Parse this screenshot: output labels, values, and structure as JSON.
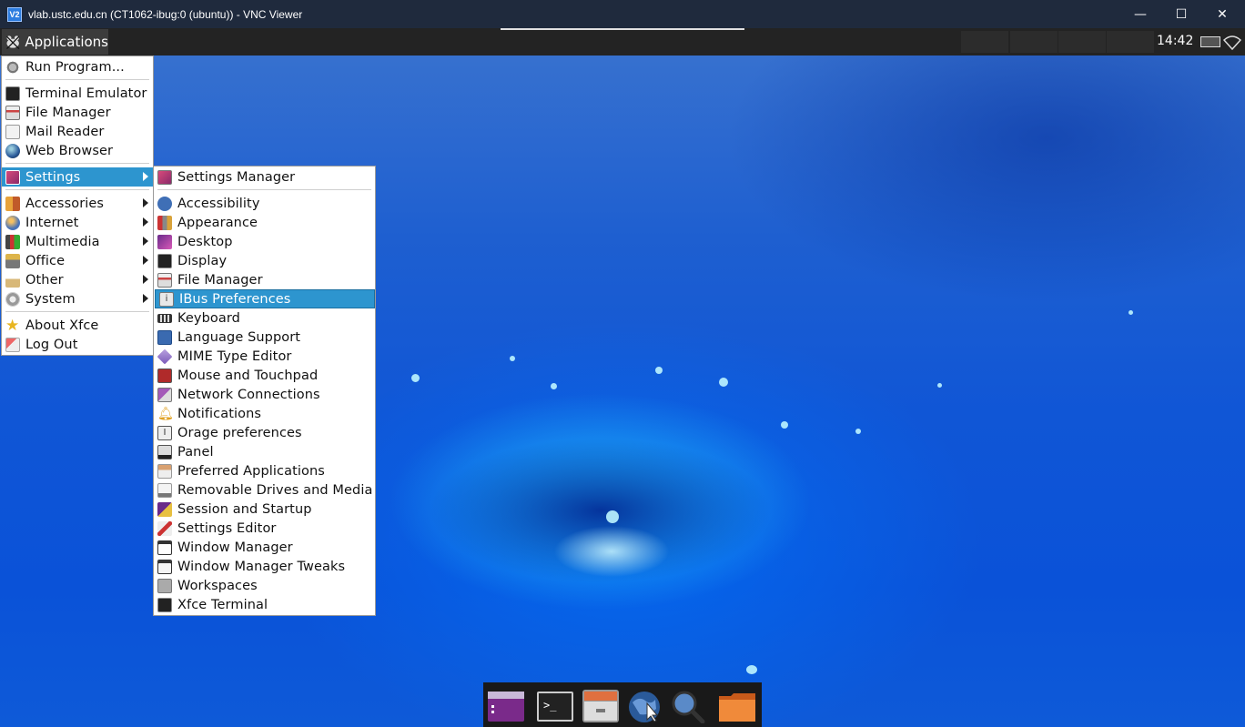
{
  "window": {
    "logo_text": "V2",
    "title": "vlab.ustc.edu.cn (CT1062-ibug:0 (ubuntu)) - VNC Viewer",
    "minimize_glyph": "—",
    "maximize_glyph": "☐",
    "close_glyph": "✕"
  },
  "panel": {
    "applications_label": "Applications",
    "clock": "14:42"
  },
  "apps_menu": {
    "items": [
      {
        "label": "Run Program...",
        "icon": "run-program-icon"
      },
      {
        "label": "Terminal Emulator",
        "icon": "terminal-icon"
      },
      {
        "label": "File Manager",
        "icon": "file-manager-icon"
      },
      {
        "label": "Mail Reader",
        "icon": "mail-icon"
      },
      {
        "label": "Web Browser",
        "icon": "web-browser-icon"
      },
      {
        "label": "Settings",
        "icon": "settings-icon",
        "submenu": true,
        "active": true
      },
      {
        "label": "Accessories",
        "icon": "accessories-icon",
        "submenu": true
      },
      {
        "label": "Internet",
        "icon": "internet-icon",
        "submenu": true
      },
      {
        "label": "Multimedia",
        "icon": "multimedia-icon",
        "submenu": true
      },
      {
        "label": "Office",
        "icon": "office-icon",
        "submenu": true
      },
      {
        "label": "Other",
        "icon": "other-icon",
        "submenu": true
      },
      {
        "label": "System",
        "icon": "system-icon",
        "submenu": true
      },
      {
        "label": "About Xfce",
        "icon": "star-icon"
      },
      {
        "label": "Log Out",
        "icon": "logout-icon"
      }
    ]
  },
  "settings_menu": {
    "items": [
      {
        "label": "Settings Manager",
        "icon": "settings-manager-icon"
      },
      {
        "label": "Accessibility",
        "icon": "accessibility-icon"
      },
      {
        "label": "Appearance",
        "icon": "appearance-icon"
      },
      {
        "label": "Desktop",
        "icon": "desktop-icon"
      },
      {
        "label": "Display",
        "icon": "display-icon"
      },
      {
        "label": "File Manager",
        "icon": "file-manager-icon"
      },
      {
        "label": "IBus Preferences",
        "icon": "ibus-icon",
        "active": true
      },
      {
        "label": "Keyboard",
        "icon": "keyboard-icon"
      },
      {
        "label": "Language Support",
        "icon": "language-icon"
      },
      {
        "label": "MIME Type Editor",
        "icon": "mime-icon"
      },
      {
        "label": "Mouse and Touchpad",
        "icon": "mouse-icon"
      },
      {
        "label": "Network Connections",
        "icon": "network-icon"
      },
      {
        "label": "Notifications",
        "icon": "bell-icon"
      },
      {
        "label": "Orage preferences",
        "icon": "orage-icon"
      },
      {
        "label": "Panel",
        "icon": "panel-icon"
      },
      {
        "label": "Preferred Applications",
        "icon": "preferred-apps-icon"
      },
      {
        "label": "Removable Drives and Media",
        "icon": "drive-icon"
      },
      {
        "label": "Session and Startup",
        "icon": "session-icon"
      },
      {
        "label": "Settings Editor",
        "icon": "settings-editor-icon"
      },
      {
        "label": "Window Manager",
        "icon": "window-manager-icon"
      },
      {
        "label": "Window Manager Tweaks",
        "icon": "wm-tweaks-icon"
      },
      {
        "label": "Workspaces",
        "icon": "workspaces-icon"
      },
      {
        "label": "Xfce Terminal",
        "icon": "terminal-icon"
      }
    ]
  },
  "dock": {
    "items": [
      "show-desktop-icon",
      "terminal-icon",
      "file-manager-icon",
      "web-browser-icon",
      "search-icon",
      "folder-icon"
    ]
  },
  "colors": {
    "menu_highlight": "#2d95cf",
    "panel_bg": "#232323",
    "titlebar_bg": "#1f2a3d"
  }
}
